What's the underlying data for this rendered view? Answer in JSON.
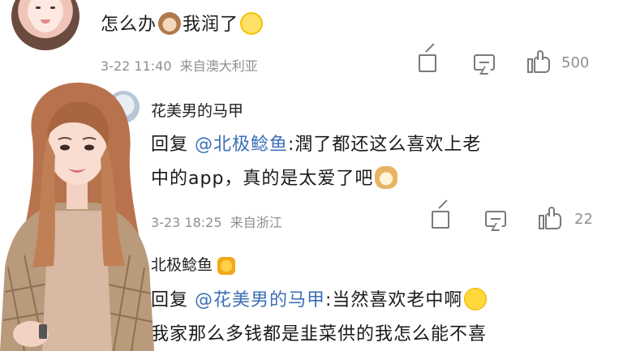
{
  "comment1": {
    "text_before": "怎么办",
    "text_after": "我润了",
    "date": "3-22 11:40",
    "location": "来自澳大利亚",
    "like_count": "500"
  },
  "reply1": {
    "author": "花美男的马甲",
    "reply_prefix": "回复 ",
    "mention": "@北极鲶鱼",
    "line1_rest": ":潤了都还这么喜欢上老",
    "line2": "中的app，真的是太爱了吧",
    "date": "3-23 18:25",
    "location": "来自浙江",
    "like_count": "22"
  },
  "reply2": {
    "author": "北极鲶鱼",
    "reply_prefix": "回复 ",
    "mention": "@花美男的马甲",
    "line1_rest": ":当然喜欢老中啊",
    "line2": "我家那么多钱都是韭菜供的我怎么能不喜"
  },
  "icons": {
    "share": "share-icon",
    "comment": "comment-icon",
    "like": "thumbs-up-icon"
  },
  "colors": {
    "mention": "#3b6fb6",
    "meta": "#8f8f8f"
  }
}
